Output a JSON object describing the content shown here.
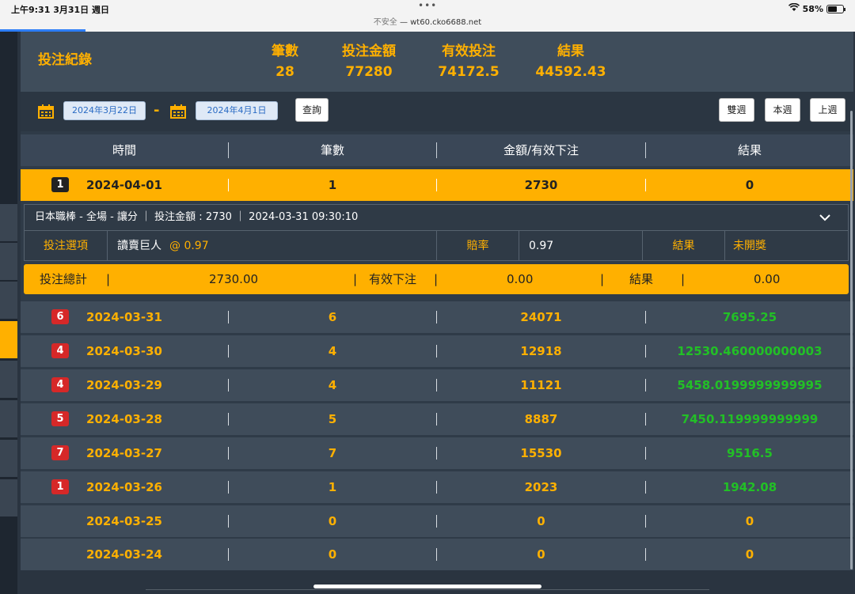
{
  "statusbar": {
    "time": "上午9:31  3月31日 週日",
    "dots": "•••",
    "insecure": "不安全",
    "url": " — wt60.cko6688.net",
    "battery": "58%",
    "wifi_icon": "wifi-icon"
  },
  "summary": {
    "title": "投注紀錄",
    "count_label": "筆數",
    "count_value": "28",
    "amount_label": "投注金額",
    "amount_value": "77280",
    "valid_label": "有效投注",
    "valid_value": "74172.5",
    "result_label": "結果",
    "result_value": "44592.43"
  },
  "filter": {
    "start_date": "2024年3月22日",
    "dash": "-",
    "end_date": "2024年4月1日",
    "query_label": "查詢",
    "two_weeks_label": "雙週",
    "this_week_label": "本週",
    "last_week_label": "上週"
  },
  "table": {
    "headers": [
      "時間",
      "筆數",
      "金額/有效下注",
      "結果"
    ],
    "rows": [
      {
        "badge": "1",
        "date": "2024-04-01",
        "count": "1",
        "amount": "2730",
        "result": "0"
      },
      {
        "badge": "6",
        "date": "2024-03-31",
        "count": "6",
        "amount": "24071",
        "result": "7695.25"
      },
      {
        "badge": "4",
        "date": "2024-03-30",
        "count": "4",
        "amount": "12918",
        "result": "12530.460000000003"
      },
      {
        "badge": "4",
        "date": "2024-03-29",
        "count": "4",
        "amount": "11121",
        "result": "5458.0199999999995"
      },
      {
        "badge": "5",
        "date": "2024-03-28",
        "count": "5",
        "amount": "8887",
        "result": "7450.119999999999"
      },
      {
        "badge": "7",
        "date": "2024-03-27",
        "count": "7",
        "amount": "15530",
        "result": "9516.5"
      },
      {
        "badge": "1",
        "date": "2024-03-26",
        "count": "1",
        "amount": "2023",
        "result": "1942.08"
      },
      {
        "badge": "",
        "date": "2024-03-25",
        "count": "0",
        "amount": "0",
        "result": "0"
      },
      {
        "badge": "",
        "date": "2024-03-24",
        "count": "0",
        "amount": "0",
        "result": "0"
      }
    ]
  },
  "detail": {
    "header": "日本職棒 - 全場 - 讓分  ｜ 投注金額 : 2730  ｜ 2024-03-31 09:30:10",
    "option_label": "投注選項",
    "option_value": "讀賣巨人",
    "option_odds": "@ 0.97",
    "odds_label": "賠率",
    "odds_value": "0.97",
    "result_label": "結果",
    "result_value": "未開獎"
  },
  "total": {
    "label": "投注總計",
    "bar": "|",
    "amount": "2730.00",
    "valid_label": "有效下注",
    "valid_value": "0.00",
    "result_label": "結果",
    "result_value": "0.00"
  },
  "colors": {
    "accent": "#ffb000",
    "win": "#22c026",
    "badge": "#d62828"
  }
}
